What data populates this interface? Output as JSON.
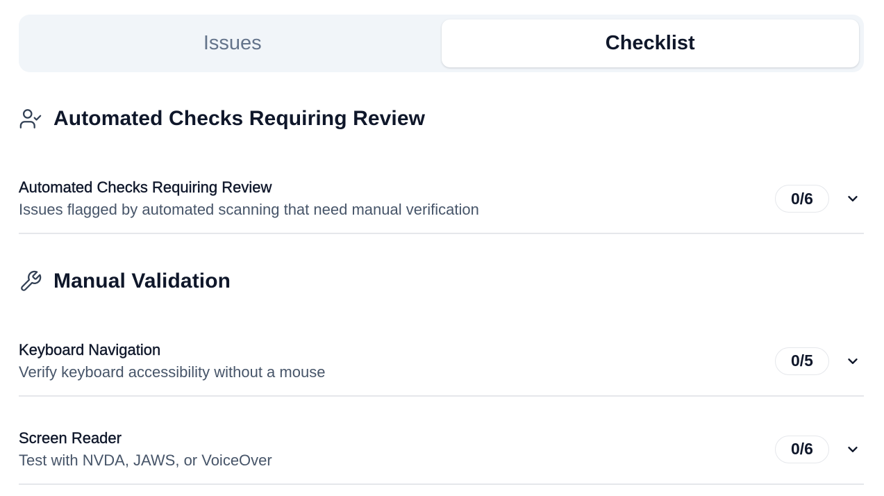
{
  "tabs": [
    {
      "label": "Issues",
      "active": false
    },
    {
      "label": "Checklist",
      "active": true
    }
  ],
  "sections": [
    {
      "title": "Automated Checks Requiring Review",
      "icon": "user-check-icon",
      "items": [
        {
          "title": "Automated Checks Requiring Review",
          "description": "Issues flagged by automated scanning that need manual verification",
          "progress": "0/6"
        }
      ]
    },
    {
      "title": "Manual Validation",
      "icon": "wrench-icon",
      "items": [
        {
          "title": "Keyboard Navigation",
          "description": "Verify keyboard accessibility without a mouse",
          "progress": "0/5"
        },
        {
          "title": "Screen Reader",
          "description": "Test with NVDA, JAWS, or VoiceOver",
          "progress": "0/6"
        }
      ]
    }
  ],
  "colors": {
    "tab_bg": "#f1f5f9",
    "active_tab_bg": "#ffffff",
    "text_primary": "#0f172a",
    "text_secondary": "#475569",
    "tab_inactive": "#64748b",
    "divider": "#e5e7eb"
  }
}
